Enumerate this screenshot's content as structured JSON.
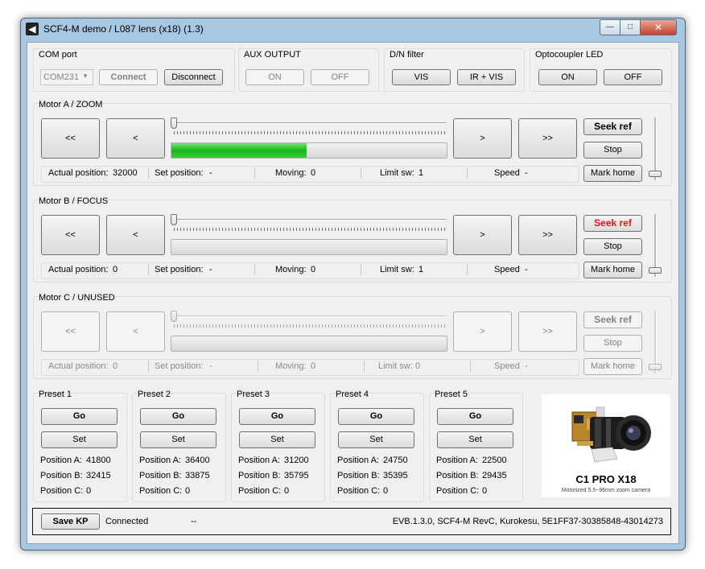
{
  "window": {
    "title": "SCF4-M demo / L087 lens (x18) (1.3)",
    "app_icon": "app-icon",
    "min_icon": "minimize-icon",
    "max_icon": "maximize-icon",
    "close_icon": "close-icon"
  },
  "com": {
    "label": "COM port",
    "port_value": "COM231",
    "connect": "Connect",
    "disconnect": "Disconnect"
  },
  "aux": {
    "label": "AUX OUTPUT",
    "on": "ON",
    "off": "OFF"
  },
  "dn": {
    "label": "D/N filter",
    "vis": "VIS",
    "irvis": "IR + VIS"
  },
  "opto": {
    "label": "Optocoupler LED",
    "on": "ON",
    "off": "OFF"
  },
  "motors": [
    {
      "label": "Motor A / ZOOM",
      "btn_fast_left": "<<",
      "btn_left": "<",
      "btn_right": ">",
      "btn_fast_right": ">>",
      "seek": "Seek ref",
      "stop": "Stop",
      "markhome": "Mark home",
      "progress_fraction": 0.49,
      "actual_label": "Actual position:",
      "actual_value": "32000",
      "set_label": "Set position:",
      "set_value": "-",
      "moving_label": "Moving:",
      "moving_value": "0",
      "limit_label": "Limit sw:",
      "limit_value": "1",
      "speed_label": "Speed",
      "speed_value": "-"
    },
    {
      "label": "Motor B / FOCUS",
      "btn_fast_left": "<<",
      "btn_left": "<",
      "btn_right": ">",
      "btn_fast_right": ">>",
      "seek": "Seek ref",
      "stop": "Stop",
      "markhome": "Mark home",
      "progress_fraction": 0,
      "actual_label": "Actual position:",
      "actual_value": "0",
      "set_label": "Set position:",
      "set_value": "-",
      "moving_label": "Moving:",
      "moving_value": "0",
      "limit_label": "Limit sw:",
      "limit_value": "1",
      "speed_label": "Speed",
      "speed_value": "-"
    },
    {
      "label": "Motor C / UNUSED",
      "btn_fast_left": "<<",
      "btn_left": "<",
      "btn_right": ">",
      "btn_fast_right": ">>",
      "seek": "Seek ref",
      "stop": "Stop",
      "markhome": "Mark home",
      "progress_fraction": 0,
      "actual_label": "Actual position:",
      "actual_value": "0",
      "set_label": "Set position:",
      "set_value": "-",
      "moving_label": "Moving:",
      "moving_value": "0",
      "limit_label": "Limit sw:",
      "limit_value": "0",
      "speed_label": "Speed",
      "speed_value": "-"
    }
  ],
  "presets": [
    {
      "label": "Preset 1",
      "go": "Go",
      "set": "Set",
      "a_label": "Position A:",
      "a": "41800",
      "b_label": "Position B:",
      "b": "32415",
      "c_label": "Position C:",
      "c": "0"
    },
    {
      "label": "Preset 2",
      "go": "Go",
      "set": "Set",
      "a_label": "Position A:",
      "a": "36400",
      "b_label": "Position B:",
      "b": "33875",
      "c_label": "Position C:",
      "c": "0"
    },
    {
      "label": "Preset 3",
      "go": "Go",
      "set": "Set",
      "a_label": "Position A:",
      "a": "31200",
      "b_label": "Position B:",
      "b": "35795",
      "c_label": "Position C:",
      "c": "0"
    },
    {
      "label": "Preset 4",
      "go": "Go",
      "set": "Set",
      "a_label": "Position A:",
      "a": "24750",
      "b_label": "Position B:",
      "b": "35395",
      "c_label": "Position C:",
      "c": "0"
    },
    {
      "label": "Preset 5",
      "go": "Go",
      "set": "Set",
      "a_label": "Position A:",
      "a": "22500",
      "b_label": "Position B:",
      "b": "29435",
      "c_label": "Position C:",
      "c": "0"
    }
  ],
  "product": {
    "name": "C1 PRO X18",
    "subtitle": "Motorized 5.5~96mm zoom camera"
  },
  "status": {
    "save": "Save KP",
    "conn": "Connected",
    "extra": "--",
    "info": "EVB.1.3.0, SCF4-M RevC, Kurokesu, 5E1FF37-30385848-43014273"
  },
  "colors": {
    "progress_green": "#16b616",
    "seek_red": "#e01818",
    "titlebar": "#a8c7e2"
  }
}
